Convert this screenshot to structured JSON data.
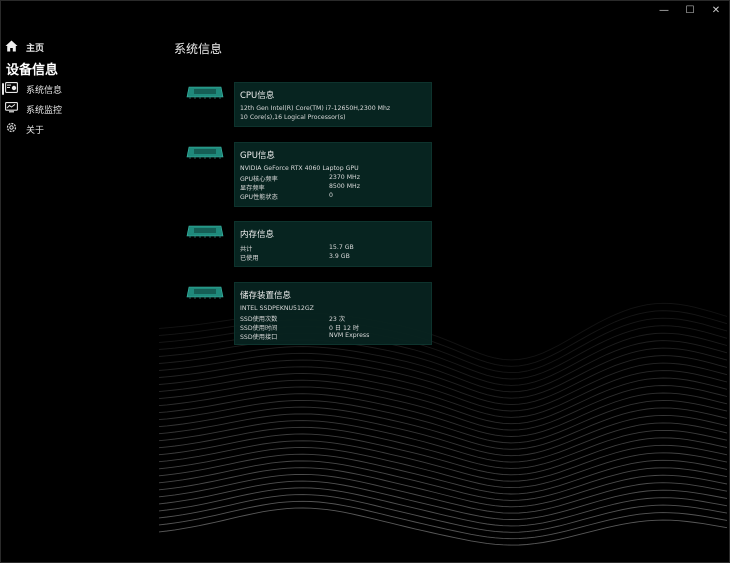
{
  "window": {
    "controls": {
      "minimize": "—",
      "maximize": "☐",
      "close": "✕"
    }
  },
  "sidebar": {
    "home": "主页",
    "section": "设备信息",
    "items": [
      {
        "label": "系统信息",
        "icon": "id-card-icon"
      },
      {
        "label": "系统监控",
        "icon": "monitor-icon"
      },
      {
        "label": "关于",
        "icon": "gear-icon"
      }
    ]
  },
  "main": {
    "title": "系统信息",
    "cards": {
      "cpu": {
        "title": "CPU信息",
        "lines": [
          "12th Gen Intel(R) Core(TM) i7-12650H,2300 Mhz",
          "10 Core(s),16 Logical Processor(s)"
        ]
      },
      "gpu": {
        "title": "GPU信息",
        "name": "NVIDIA GeForce RTX 4060 Laptop GPU",
        "rows": [
          {
            "label": "GPU核心频率",
            "value": "2370 MHz"
          },
          {
            "label": "显存频率",
            "value": "8500 MHz"
          },
          {
            "label": "GPU性能状态",
            "value": "0"
          }
        ]
      },
      "memory": {
        "title": "内存信息",
        "rows": [
          {
            "label": "共计",
            "value": "15.7 GB"
          },
          {
            "label": "已使用",
            "value": "3.9 GB"
          }
        ]
      },
      "storage": {
        "title": "储存装置信息",
        "name": "INTEL SSDPEKNU512GZ",
        "rows": [
          {
            "label": "SSD使用次数",
            "value": "23 次"
          },
          {
            "label": "SSD使用时间",
            "value": "0 日 12 时"
          },
          {
            "label": "SSD使用接口",
            "value": "NVM Express"
          }
        ]
      }
    }
  },
  "colors": {
    "background": "#000000",
    "card": "#072420",
    "accent": "#2fa898"
  }
}
